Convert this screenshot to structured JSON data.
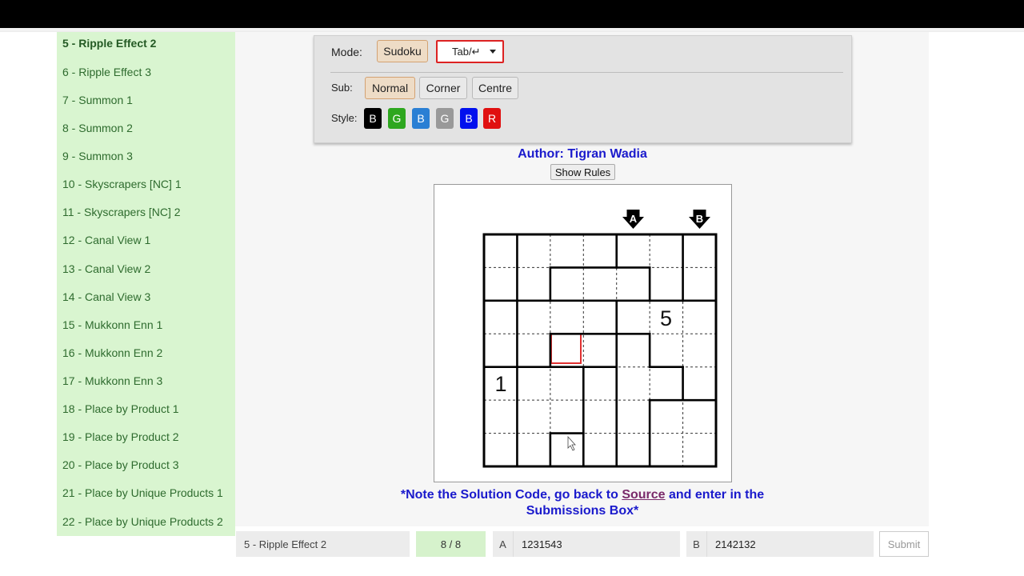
{
  "sidebar": {
    "active_index": 0,
    "items": [
      "5 - Ripple Effect 2",
      "6 - Ripple Effect 3",
      "7 - Summon 1",
      "8 - Summon 2",
      "9 - Summon 3",
      "10 - Skyscrapers [NC] 1",
      "11 - Skyscrapers [NC] 2",
      "12 - Canal View 1",
      "13 - Canal View 2",
      "14 - Canal View 3",
      "15 - Mukkonn Enn 1",
      "16 - Mukkonn Enn 2",
      "17 - Mukkonn Enn 3",
      "18 - Place by Product 1",
      "19 - Place by Product 2",
      "20 - Place by Product 3",
      "21 - Place by Unique Products 1",
      "22 - Place by Unique Products 2"
    ]
  },
  "toolbar": {
    "mode_label": "Mode:",
    "mode_button": "Sudoku",
    "mode_select": "Tab/↵",
    "sub_label": "Sub:",
    "sub_options": [
      "Normal",
      "Corner",
      "Centre"
    ],
    "sub_selected": "Normal",
    "style_label": "Style:",
    "styles": [
      {
        "letter": "B",
        "color": "#000000"
      },
      {
        "letter": "G",
        "color": "#2ea71f"
      },
      {
        "letter": "B",
        "color": "#2a7fd4"
      },
      {
        "letter": "G",
        "color": "#999999"
      },
      {
        "letter": "B",
        "color": "#0010ee"
      },
      {
        "letter": "R",
        "color": "#e01010"
      }
    ]
  },
  "puzzle": {
    "author": "Author: Tigran Wadia",
    "show_rules": "Show Rules",
    "arrow_labels": [
      "A",
      "B"
    ],
    "givens": [
      {
        "row": 2,
        "col": 5,
        "value": "5"
      },
      {
        "row": 4,
        "col": 0,
        "value": "1"
      }
    ],
    "selected_cell": {
      "row": 3,
      "col": 2
    },
    "selection_color": "#e03030"
  },
  "note": {
    "part1": "*Note the Solution Code, go back to ",
    "link": "Source",
    "part2": " and enter in the Submissions Box*"
  },
  "footer": {
    "puzzle_name": "5 - Ripple Effect 2",
    "progress": "8 / 8",
    "answer_a_label": "A",
    "answer_a": "1231543",
    "answer_b_label": "B",
    "answer_b": "2142132",
    "submit": "Submit"
  }
}
